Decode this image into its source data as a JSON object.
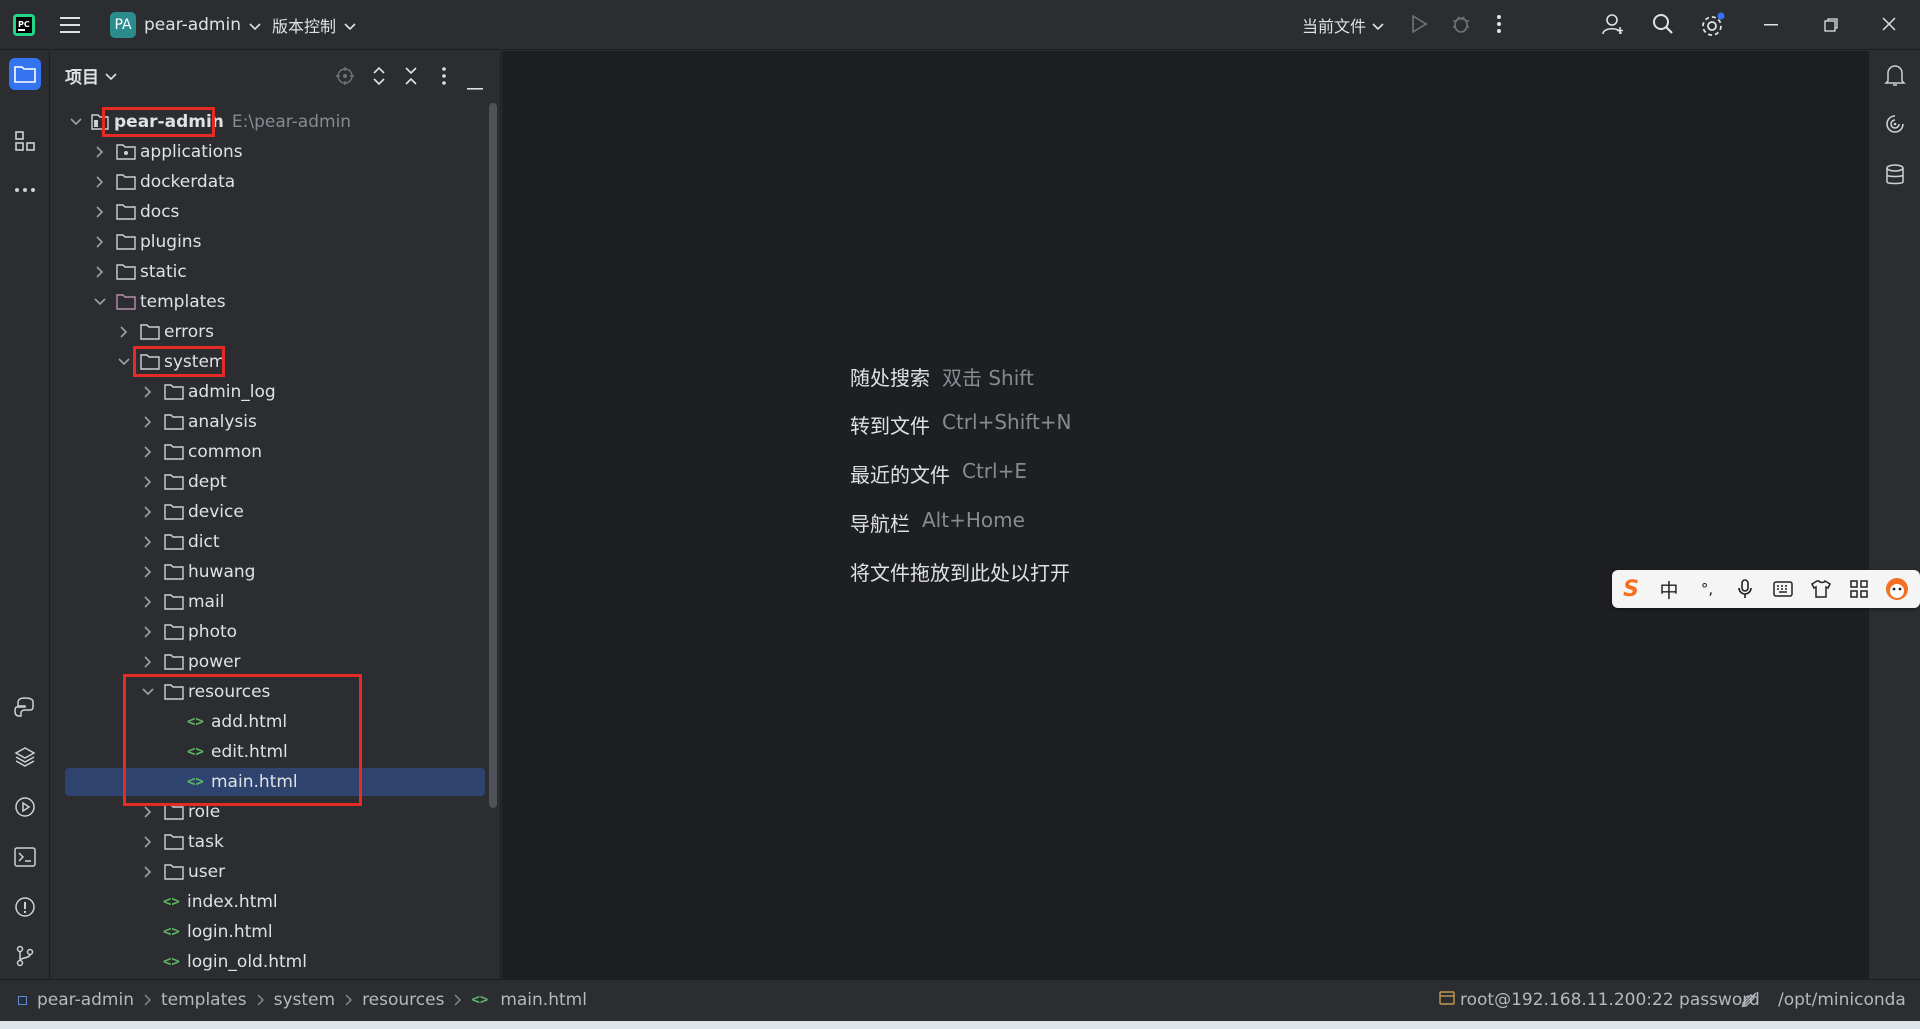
{
  "titlebar": {
    "project_badge": "PA",
    "project_name": "pear-admin",
    "vcs_label": "版本控制",
    "run_config": "当前文件"
  },
  "panel": {
    "title": "项目"
  },
  "tree": {
    "root_name": "pear-admin",
    "root_path": "E:\\pear-admin",
    "applications": "applications",
    "dockerdata": "dockerdata",
    "docs": "docs",
    "plugins": "plugins",
    "static": "static",
    "templates": "templates",
    "errors": "errors",
    "system": "system",
    "admin_log": "admin_log",
    "analysis": "analysis",
    "common": "common",
    "dept": "dept",
    "device": "device",
    "dict": "dict",
    "huwang": "huwang",
    "mail": "mail",
    "photo": "photo",
    "power": "power",
    "resources": "resources",
    "add_html": "add.html",
    "edit_html": "edit.html",
    "main_html": "main.html",
    "role": "role",
    "task": "task",
    "user": "user",
    "index_html": "index.html",
    "login_html": "login.html",
    "login_old_html": "login_old.html"
  },
  "editor_hints": [
    {
      "label": "随处搜索",
      "key": "双击 Shift"
    },
    {
      "label": "转到文件",
      "key": "Ctrl+Shift+N"
    },
    {
      "label": "最近的文件",
      "key": "Ctrl+E"
    },
    {
      "label": "导航栏",
      "key": "Alt+Home"
    },
    {
      "label": "将文件拖放到此处以打开",
      "key": ""
    }
  ],
  "ime": {
    "mode": "中",
    "punct": "°,"
  },
  "breadcrumb": [
    "pear-admin",
    "templates",
    "system",
    "resources",
    "main.html"
  ],
  "status": {
    "remote": "root@192.168.11.200:22 password",
    "interpreter": "/opt/miniconda"
  },
  "colors": {
    "accent": "#3574f0",
    "selection": "#2e436e",
    "highlight_box": "#e62b25",
    "html_icon": "#5fb865",
    "templates_folder": "#b48ead"
  }
}
